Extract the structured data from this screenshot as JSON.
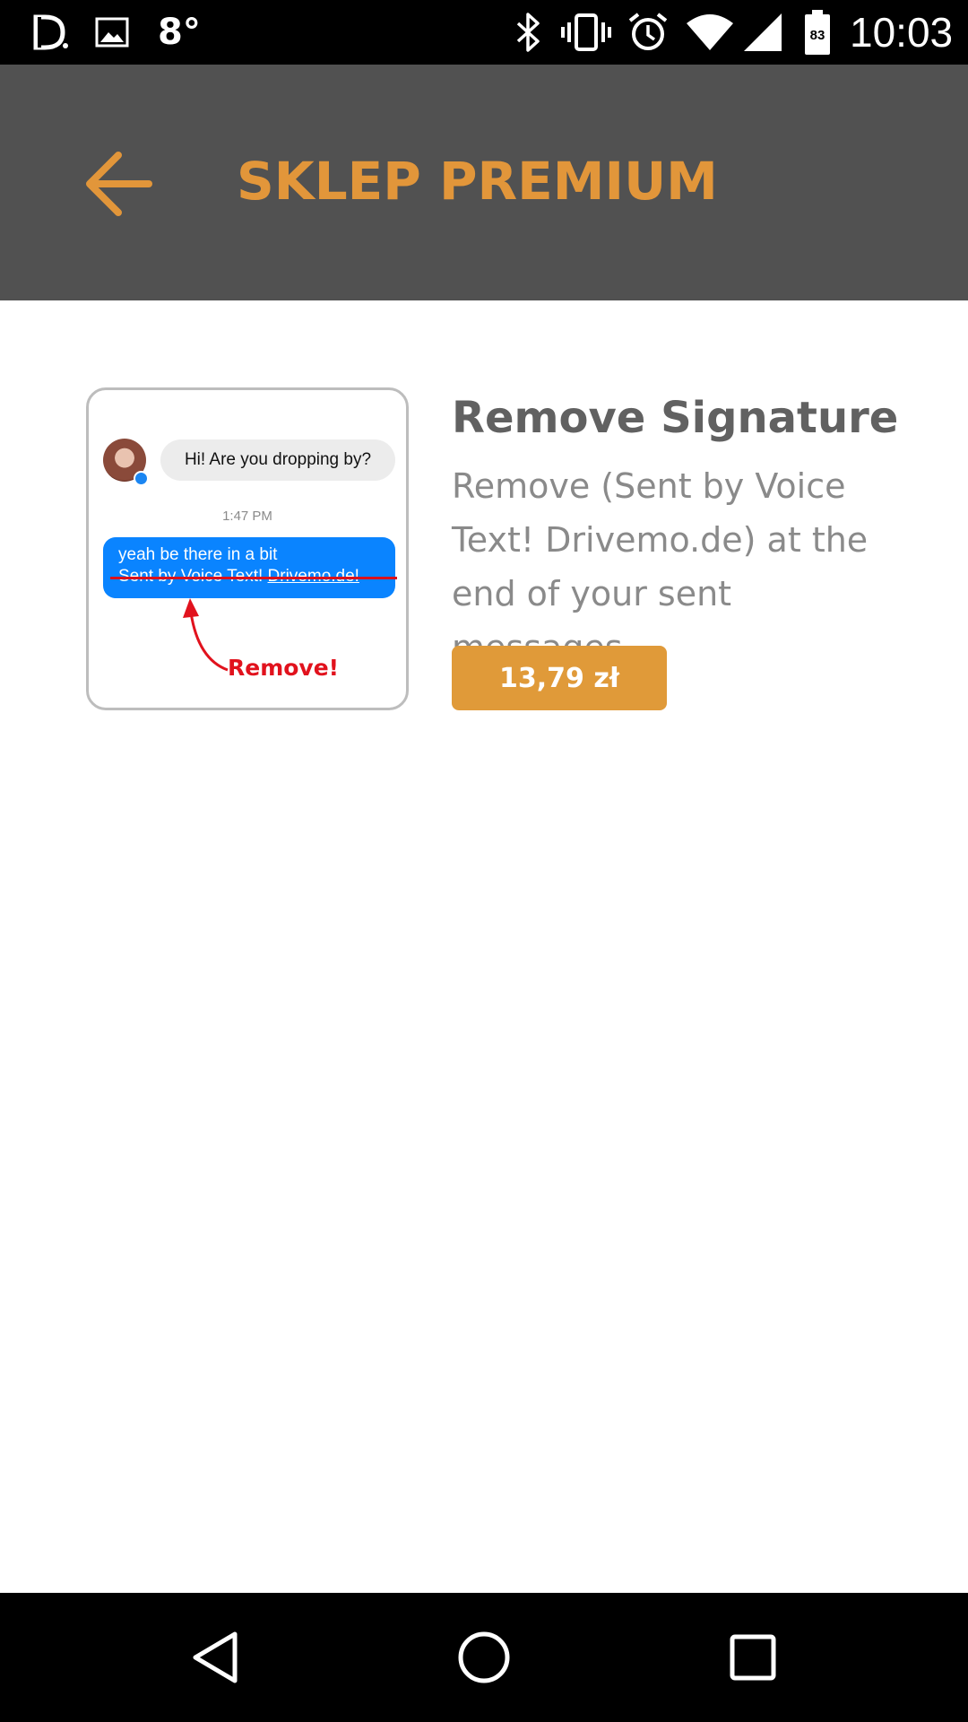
{
  "status_bar": {
    "temperature": "8°",
    "time": "10:03",
    "battery_level": "83",
    "icons": [
      "d-app-icon",
      "gallery-icon",
      "bluetooth-icon",
      "vibrate-icon",
      "alarm-icon",
      "wifi-icon",
      "signal-icon",
      "battery-icon"
    ]
  },
  "app_bar": {
    "title": "SKLEP PREMIUM",
    "back_icon": "arrow-left-icon",
    "accent_color": "#e2963a",
    "background_color": "#515151"
  },
  "product": {
    "title": "Remove Signature",
    "description": "Remove (Sent by Voice Text! Drivemo.de) at the end of your sent messages.",
    "price": "13,79 zł",
    "price_button_color": "#e09a39",
    "preview": {
      "incoming_message": "Hi! Are you dropping by?",
      "timestamp": "1:47 PM",
      "outgoing_message": "yeah be there in a bit",
      "signature_prefix": "Sent by Voice Text!",
      "signature_link": "Drivemo.de!",
      "callout": "Remove!"
    }
  },
  "nav_bar": {
    "icons": [
      "back-triangle-icon",
      "home-circle-icon",
      "recents-square-icon"
    ]
  }
}
